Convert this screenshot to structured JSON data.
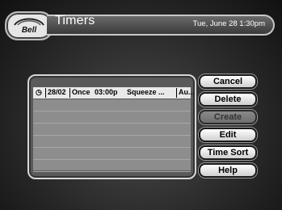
{
  "header": {
    "logo_text": "Bell",
    "title": "Timers",
    "datetime": "Tue, June 28 1:30pm"
  },
  "timers": [
    {
      "icon": "clock-icon",
      "date": "28/02",
      "frequency": "Once",
      "time": "03:00p",
      "name": "Squeeze ...",
      "channel": "Au..."
    }
  ],
  "buttons": {
    "cancel": "Cancel",
    "delete": "Delete",
    "create": "Create",
    "edit": "Edit",
    "time_sort": "Time Sort",
    "help": "Help"
  },
  "colors": {
    "titlebar": "#4f4f4f",
    "selected_row": "#e9e9e9",
    "button_face": "#f0f0f0"
  }
}
